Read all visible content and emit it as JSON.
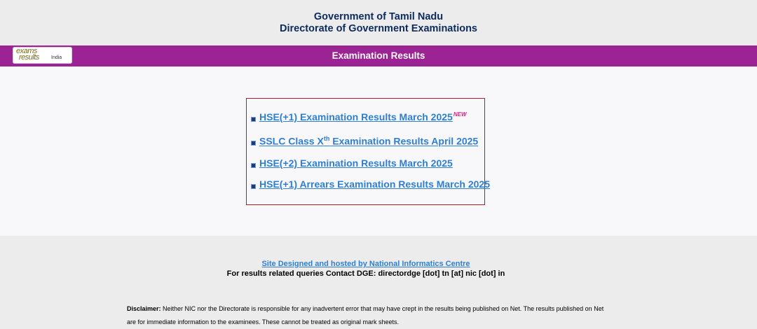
{
  "header": {
    "line1": "Government of Tamil Nadu",
    "line2": "Directorate of Government Examinations"
  },
  "banner": {
    "logo_word1": "exams",
    "logo_word2": "results",
    "logo_word3": "India",
    "title": "Examination Results",
    "color": "#9b2394"
  },
  "results": {
    "links": [
      {
        "label": "HSE(+1) Examination Results March 2025",
        "badge": "NEW"
      },
      {
        "label_pre": "SSLC Class X",
        "label_sup": "th",
        "label_post": " Examination Results April 2025"
      },
      {
        "label": "HSE(+2) Examination Results March 2025"
      },
      {
        "label": "HSE(+1) Arrears Examination Results March 2025"
      }
    ],
    "border_color": "#b01e2a",
    "link_color": "#2f7fd0"
  },
  "footer": {
    "site_link": "Site Designed and hosted by National Informatics Centre",
    "contact": "For results related queries Contact DGE:  directordge [dot] tn [at] nic [dot] in",
    "disclaimer_label": "Disclaimer:",
    "disclaimer_text": " Neither NIC nor the Directorate is responsible for any inadvertent error that may have crept in the results being published on Net. The results published on Net are for immediate information to the examinees. These cannot be treated as original mark sheets."
  }
}
